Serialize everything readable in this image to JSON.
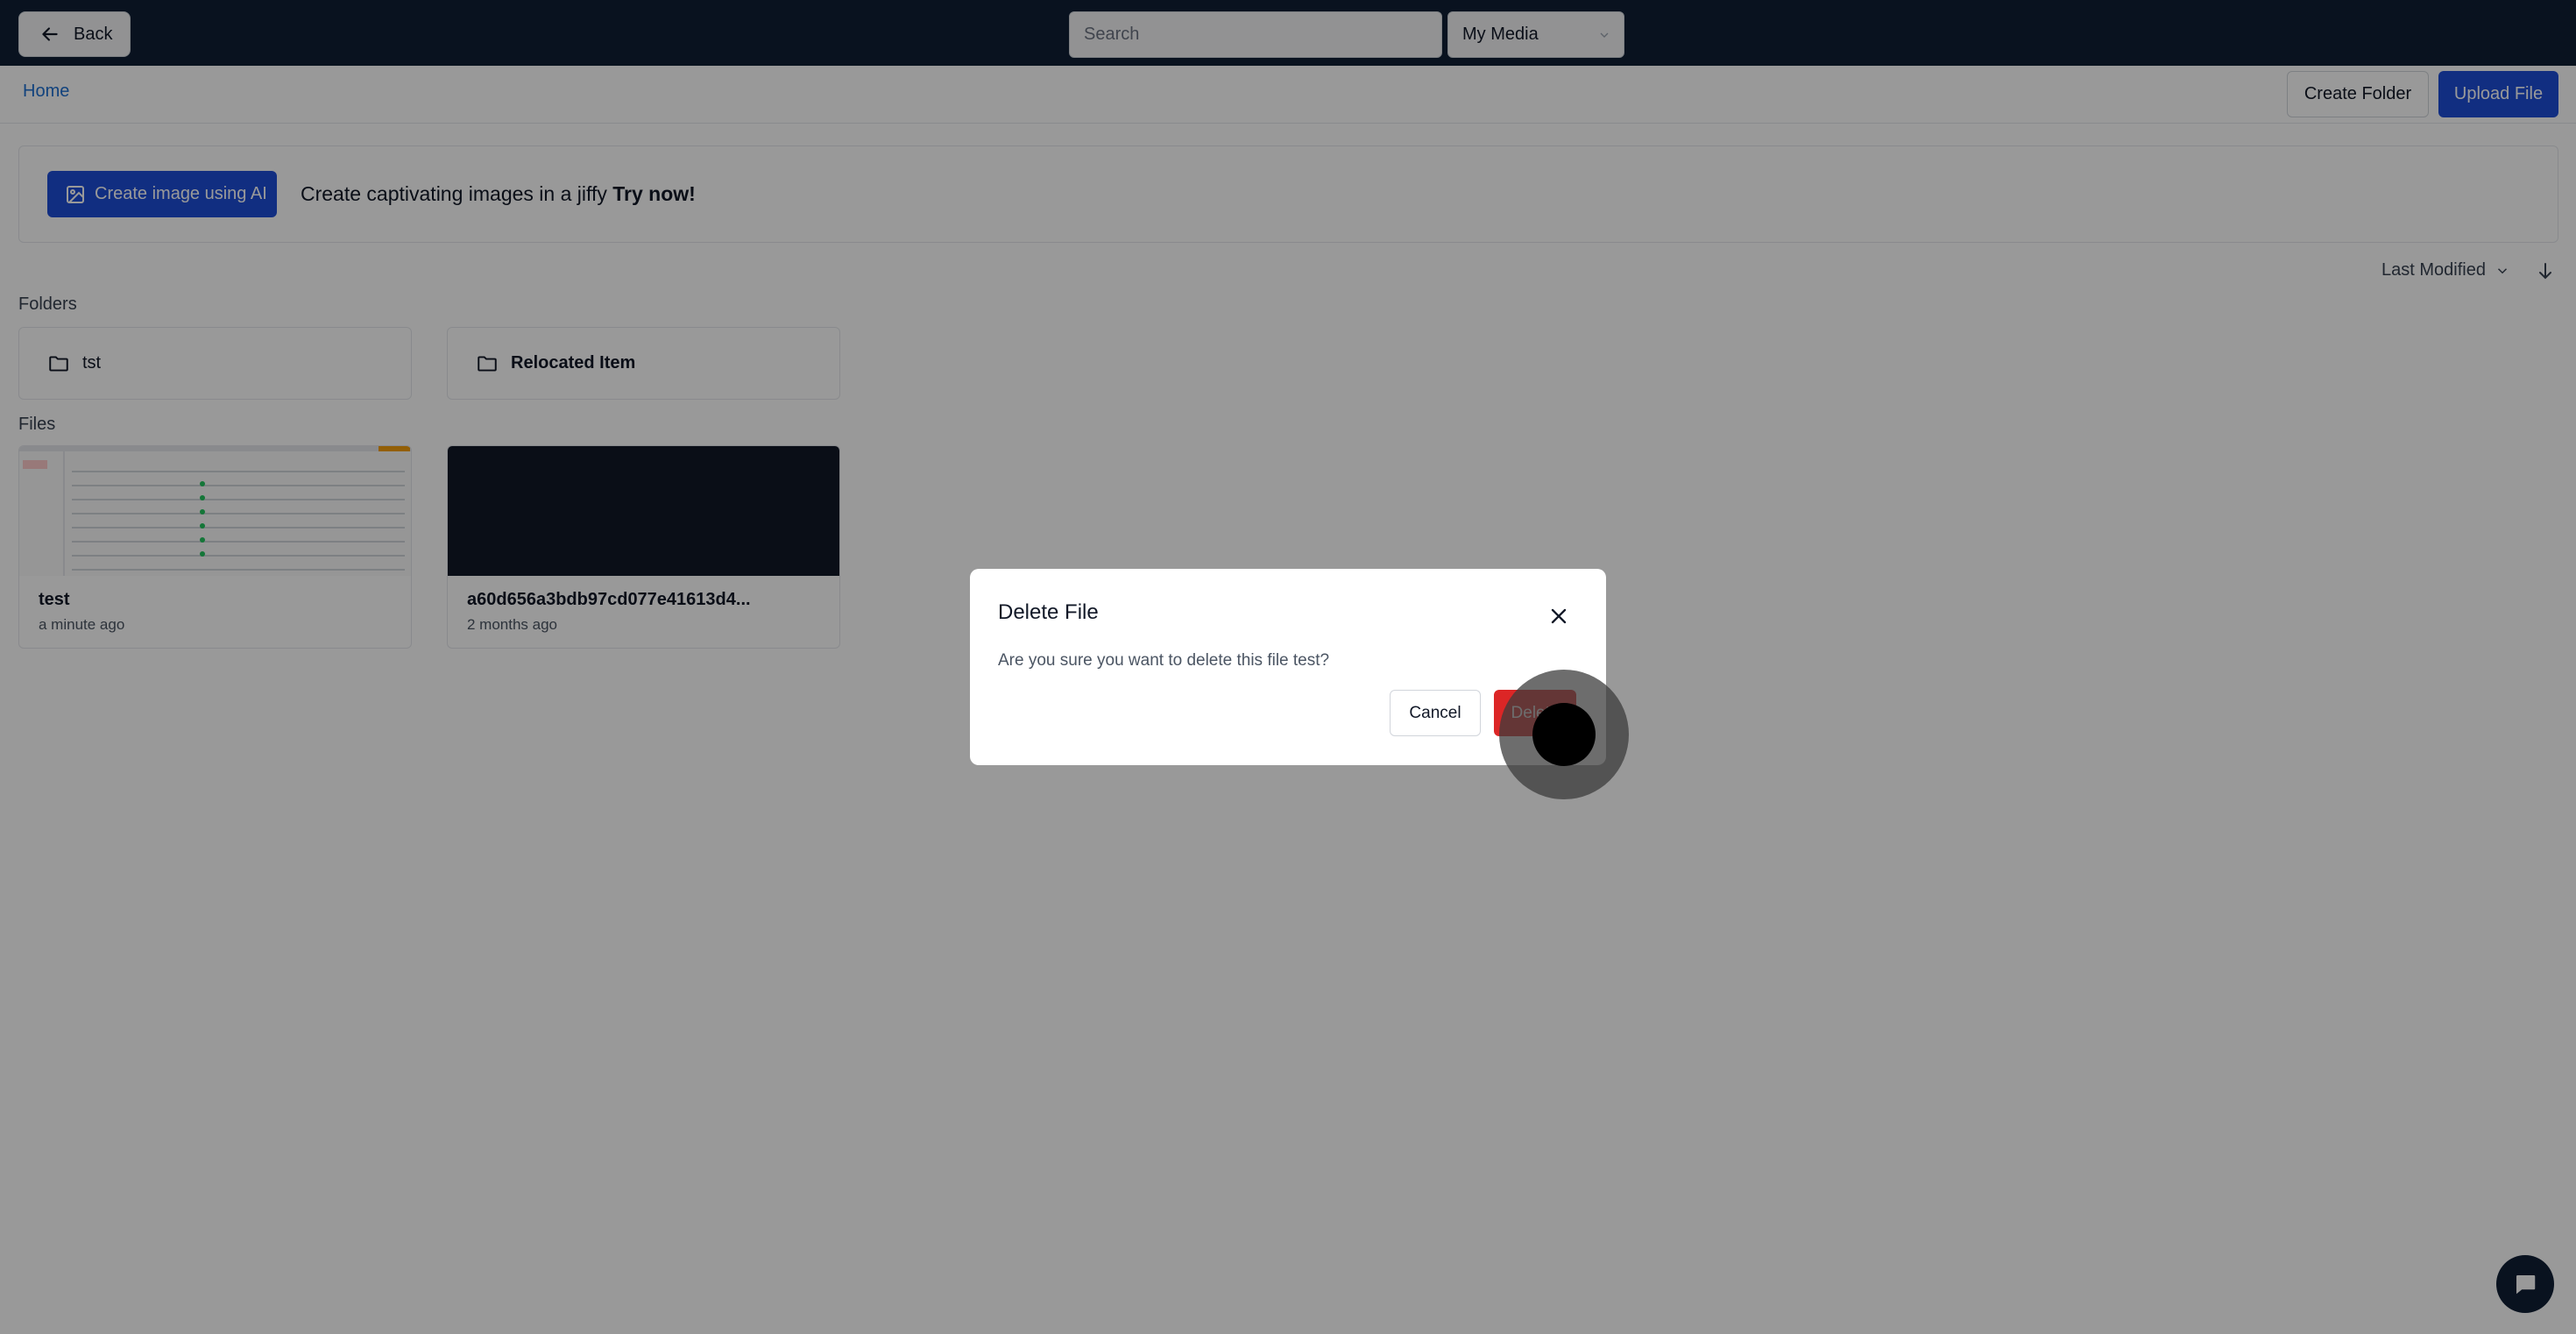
{
  "topbar": {
    "back_label": "Back",
    "search_placeholder": "Search",
    "media_select": "My Media"
  },
  "subheader": {
    "breadcrumb_home": "Home",
    "create_folder_label": "Create Folder",
    "upload_file_label": "Upload File"
  },
  "ai_banner": {
    "button_label": "Create image using AI",
    "text": "Create captivating images in a jiffy",
    "cta": "Try now!"
  },
  "sort": {
    "label": "Last Modified"
  },
  "folders": {
    "heading": "Folders",
    "items": [
      {
        "name": "tst"
      },
      {
        "name": "Relocated Item"
      }
    ]
  },
  "files": {
    "heading": "Files",
    "items": [
      {
        "name": "test",
        "time": "a minute ago"
      },
      {
        "name": "a60d656a3bdb97cd077e41613d4...",
        "time": "2 months ago"
      }
    ]
  },
  "modal": {
    "title": "Delete File",
    "message": "Are you sure you want to delete this file test?",
    "cancel_label": "Cancel",
    "delete_label": "Delete"
  },
  "colors": {
    "topbar": "#0f1e35",
    "primary": "#1d4ed8",
    "danger": "#dc2626",
    "link": "#1d6fd0"
  }
}
